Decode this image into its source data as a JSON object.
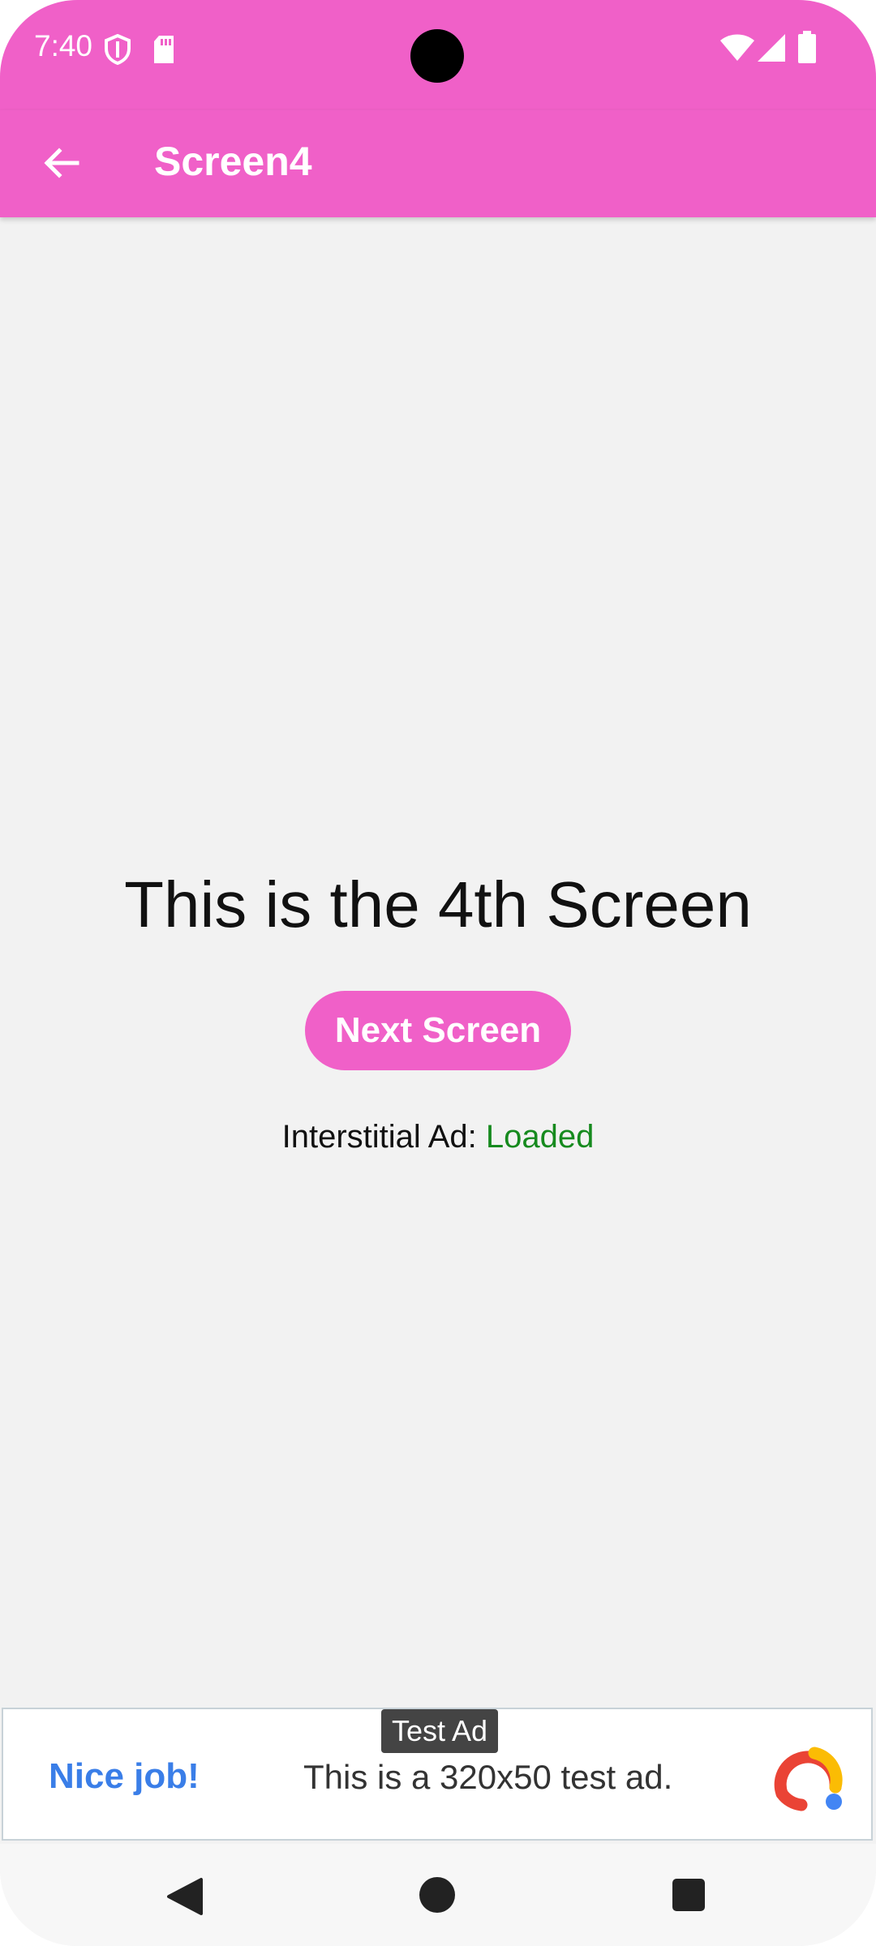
{
  "status_bar": {
    "time": "7:40",
    "icons": [
      "shield-icon",
      "sd-card-icon",
      "wifi-icon",
      "signal-icon",
      "battery-icon"
    ]
  },
  "app_bar": {
    "title": "Screen4",
    "back_icon": "arrow-back-icon"
  },
  "main": {
    "heading": "This is the 4th Screen",
    "next_button_label": "Next Screen",
    "ad_status_label": "Interstitial Ad: ",
    "ad_status_value": "Loaded"
  },
  "ad_banner": {
    "tag": "Test Ad",
    "headline": "Nice job!",
    "body": "This is a 320x50 test ad.",
    "logo_icon": "admob-logo-icon"
  },
  "nav_bar": {
    "icons": [
      "back-triangle-icon",
      "home-circle-icon",
      "recents-square-icon"
    ]
  },
  "colors": {
    "accent": "#f060c8",
    "loaded": "#168a1e",
    "ad_headline": "#3a7ee8"
  }
}
